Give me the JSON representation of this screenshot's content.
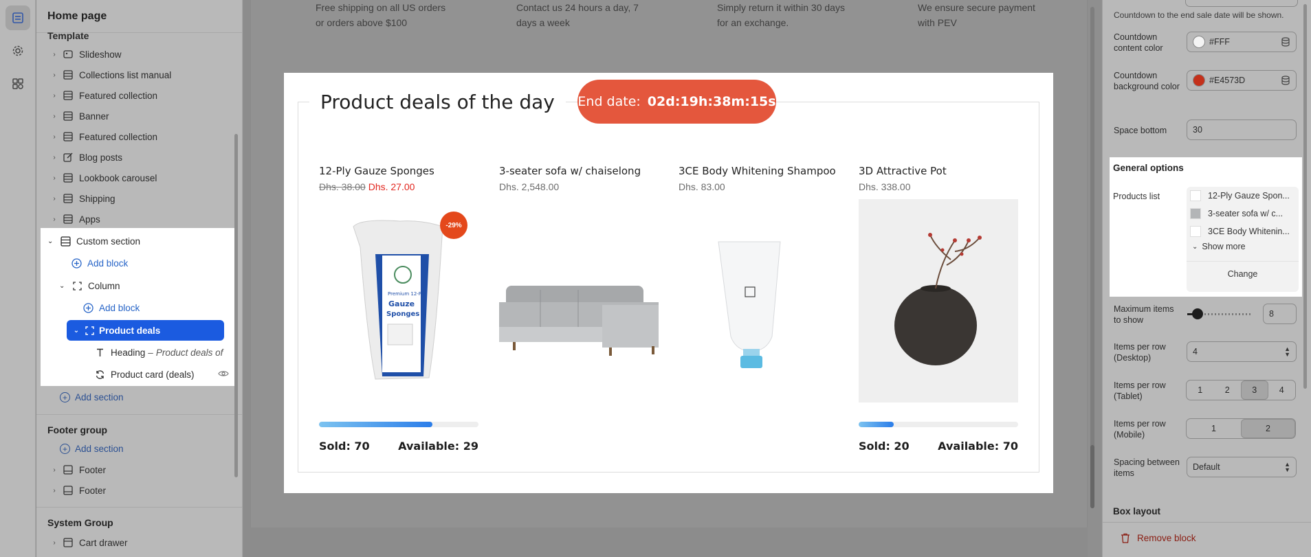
{
  "left_panel": {
    "header": "Home page",
    "template_label": "Template",
    "sections": [
      {
        "label": "Slideshow",
        "icon": "slideshow-icon"
      },
      {
        "label": "Collections list manual",
        "icon": "section-icon"
      },
      {
        "label": "Featured collection",
        "icon": "section-icon"
      },
      {
        "label": "Banner",
        "icon": "section-icon"
      },
      {
        "label": "Featured collection",
        "icon": "section-icon"
      },
      {
        "label": "Blog posts",
        "icon": "edit-icon"
      },
      {
        "label": "Lookbook carousel",
        "icon": "section-icon"
      },
      {
        "label": "Shipping",
        "icon": "section-icon"
      },
      {
        "label": "Apps",
        "icon": "section-icon"
      }
    ],
    "custom_section": {
      "label": "Custom section",
      "add_block": "Add block",
      "column_label": "Column",
      "column_add_block": "Add block",
      "selected_block": "Product deals",
      "heading_item": "Heading",
      "heading_item_detail": "Product deals of",
      "product_card_item": "Product card (deals)"
    },
    "add_section": "Add section",
    "footer_group": {
      "label": "Footer group",
      "add_section": "Add section",
      "items": [
        "Footer",
        "Footer"
      ]
    },
    "system_group": {
      "label": "System Group",
      "items": [
        "Cart drawer"
      ]
    }
  },
  "preview": {
    "features": [
      {
        "line1": "Free shipping on all US orders",
        "line2": "or orders above $100"
      },
      {
        "line1": "Contact us 24 hours a day, 7",
        "line2": "days a week"
      },
      {
        "line1": "Simply return it within 30 days",
        "line2": "for an exchange."
      },
      {
        "line1": "We ensure secure payment",
        "line2": "with PEV"
      }
    ],
    "deals": {
      "title": "Product deals of the day",
      "end_label": "End date:",
      "countdown": "02d:19h:38m:15s",
      "products": [
        {
          "name": "12-Ply Gauze Sponges",
          "old_price": "Dhs. 38.00",
          "price": "Dhs. 27.00",
          "discount": "-29%",
          "sold": "Sold: 70",
          "available": "Available: 29",
          "progress": 0.71,
          "image": "gauze-package"
        },
        {
          "name": "3-seater sofa w/ chaiselong",
          "price": "Dhs. 2,548.00",
          "image": "gray-sofa"
        },
        {
          "name": "3CE Body Whitening Shampoo",
          "price": "Dhs. 83.00",
          "image": "shampoo-tube"
        },
        {
          "name": "3D Attractive Pot",
          "price": "Dhs. 338.00",
          "sold": "Sold: 20",
          "available": "Available: 70",
          "progress": 0.22,
          "image": "vase-with-branches"
        }
      ]
    }
  },
  "right_panel": {
    "countdown_hint": "Countdown to the end sale date will be shown.",
    "countdown_content_color_label": "Countdown content color",
    "countdown_content_color": "#FFF",
    "countdown_bg_color_label": "Countdown background color",
    "countdown_bg_color": "#E4573D",
    "space_bottom_label": "Space bottom",
    "space_bottom": "30",
    "general_options": "General options",
    "products_list_label": "Products list",
    "products_list": [
      "12-Ply Gauze Spon...",
      "3-seater sofa w/ c...",
      "3CE Body Whitenin..."
    ],
    "show_more": "Show more",
    "change": "Change",
    "max_items_label": "Maximum items to show",
    "max_items": "8",
    "max_items_slider": 0.08,
    "items_desktop_label": "Items per row (Desktop)",
    "items_desktop": "4",
    "items_tablet_label": "Items per row (Tablet)",
    "items_tablet_options": [
      "1",
      "2",
      "3",
      "4"
    ],
    "items_tablet_selected": "3",
    "items_mobile_label": "Items per row (Mobile)",
    "items_mobile_options": [
      "1",
      "2"
    ],
    "items_mobile_selected": "2",
    "spacing_label": "Spacing between items",
    "spacing_value": "Default",
    "box_layout": "Box layout",
    "remove_block": "Remove block"
  },
  "colors": {
    "accent": "#1B5BE0",
    "badge": "#E4573D",
    "sale_price": "#E2261E",
    "progress": "#2B7DE9"
  }
}
